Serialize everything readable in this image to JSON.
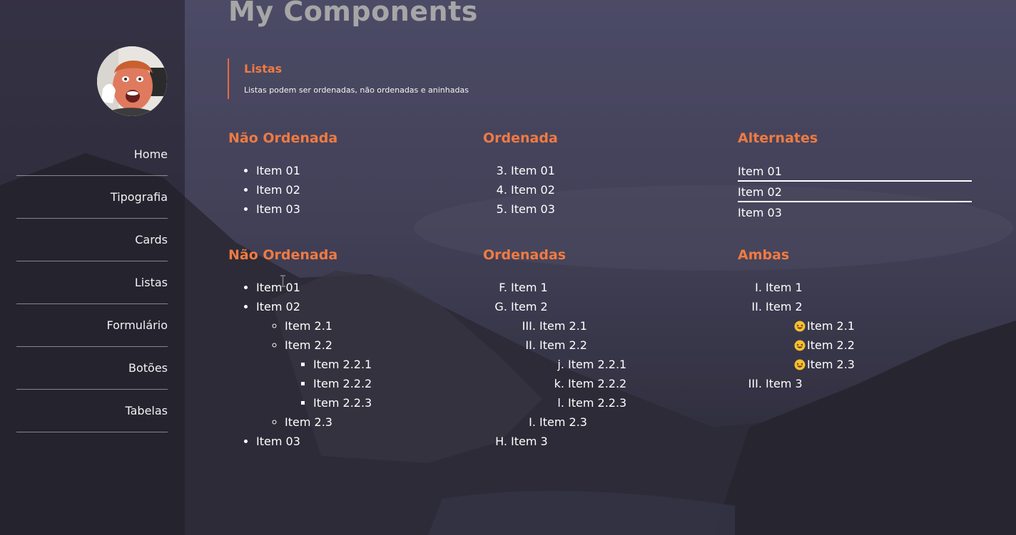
{
  "page_title": "My Components",
  "sidebar": {
    "nav": [
      "Home",
      "Tipografia",
      "Cards",
      "Listas",
      "Formulário",
      "Botões",
      "Tabelas"
    ]
  },
  "callout": {
    "title": "Listas",
    "text": "Listas podem ser ordenadas, não ordenadas e aninhadas"
  },
  "sections": {
    "unordered": {
      "title": "Não Ordenada",
      "items": [
        "Item 01",
        "Item 02",
        "Item 03"
      ]
    },
    "ordered": {
      "title": "Ordenada",
      "start": 3,
      "items": [
        "Item 01",
        "Item 02",
        "Item 03"
      ]
    },
    "alternates": {
      "title": "Alternates",
      "items": [
        "Item 01",
        "Item 02",
        "Item 03"
      ]
    },
    "nested_unordered": {
      "title": "Não Ordenada",
      "item1": "Item 01",
      "item2": "Item 02",
      "sub_a": "Item 2.1",
      "sub_b": "Item 2.2",
      "subsub_a": "Item 2.2.1",
      "subsub_b": "Item 2.2.2",
      "subsub_c": "Item 2.2.3",
      "sub_c": "Item 2.3",
      "item3": "Item 03"
    },
    "nested_ordered": {
      "title": "Ordenadas",
      "item1": "Item 1",
      "item2": "Item 2",
      "sub_a": "Item 2.1",
      "sub_b": "Item 2.2",
      "subsub_a": "Item 2.2.1",
      "subsub_b": "Item 2.2.2",
      "subsub_c": "Item 2.2.3",
      "sub_c": "Item 2.3",
      "item3": "Item 3"
    },
    "both": {
      "title": "Ambas",
      "item1": "Item 1",
      "item2": "Item 2",
      "sub_a": "Item 2.1",
      "sub_b": "Item 2.2",
      "sub_c": "Item 2.3",
      "item3": "Item 3"
    }
  },
  "colors": {
    "accent": "#f07a42",
    "title_gray": "#a6a6a6"
  }
}
